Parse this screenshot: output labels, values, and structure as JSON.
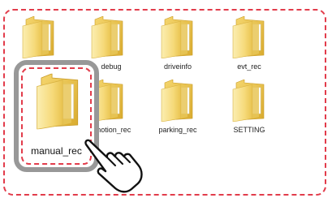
{
  "folders": [
    {
      "label": ""
    },
    {
      "label": "debug"
    },
    {
      "label": "driveinfo"
    },
    {
      "label": "evt_rec"
    },
    {
      "label": ""
    },
    {
      "label": "motion_rec"
    },
    {
      "label": "parking_rec"
    },
    {
      "label": "SETTING"
    }
  ],
  "selected_folder": {
    "label": "manual_rec"
  },
  "colors": {
    "dash": "#e23c4b",
    "selection_border": "#989898",
    "folder_light": "#f7e08a",
    "folder_dark": "#e4bf4a"
  },
  "icons": {
    "folder": "folder-icon",
    "cursor": "pointing-hand-cursor-icon"
  }
}
